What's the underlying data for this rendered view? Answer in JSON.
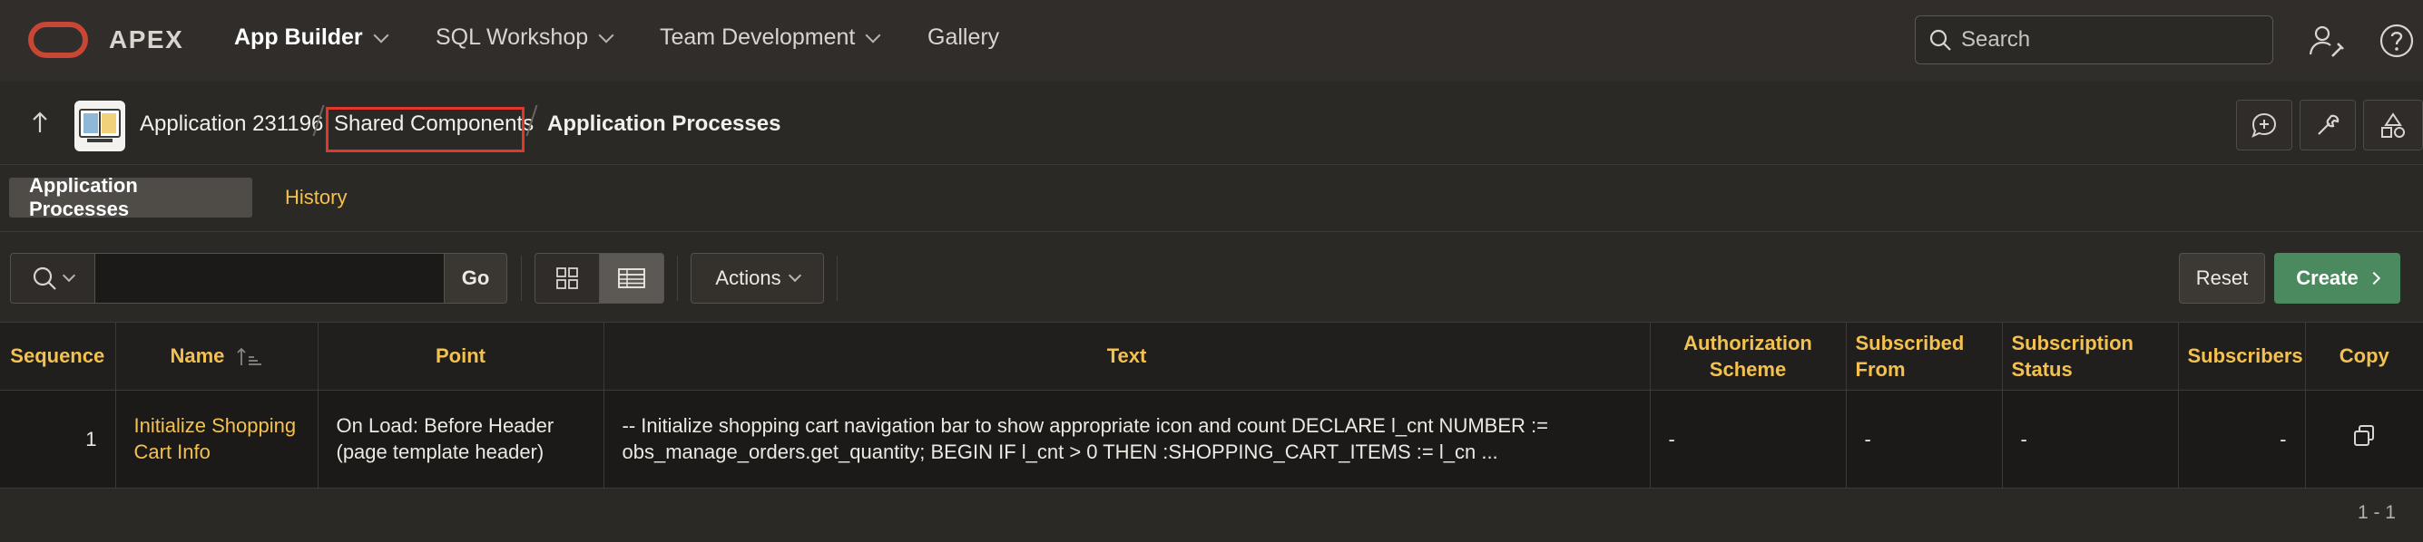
{
  "header": {
    "brand": "APEX",
    "nav": [
      {
        "label": "App Builder",
        "active": true,
        "has_menu": true
      },
      {
        "label": "SQL Workshop",
        "active": false,
        "has_menu": true
      },
      {
        "label": "Team Development",
        "active": false,
        "has_menu": true
      },
      {
        "label": "Gallery",
        "active": false,
        "has_menu": false
      }
    ],
    "search_placeholder": "Search",
    "icons": [
      "user-settings-icon",
      "help-icon"
    ],
    "colors": {
      "brand_red": "#c74634",
      "accent": "#f3c14f",
      "create_green": "#4b8a5e"
    }
  },
  "breadcrumb": {
    "items": [
      "Application 231196",
      "Shared Components",
      "Application Processes"
    ],
    "highlighted": "Shared Components",
    "tools": [
      "comment-add-icon",
      "wrench-icon",
      "shapes-icon"
    ]
  },
  "tabs": [
    {
      "label": "Application Processes",
      "active": true
    },
    {
      "label": "History",
      "active": false
    }
  ],
  "toolbar": {
    "search_value": "",
    "go_label": "Go",
    "actions_label": "Actions",
    "reset_label": "Reset",
    "create_label": "Create"
  },
  "table": {
    "columns": [
      "Sequence",
      "Name",
      "Point",
      "Text",
      "Authorization Scheme",
      "Subscribed From",
      "Subscription Status",
      "Subscribers",
      "Copy"
    ],
    "rows": [
      {
        "sequence": "1",
        "name": "Initialize Shopping Cart Info",
        "point": "On Load: Before Header (page template header)",
        "text": "-- Initialize shopping cart navigation bar to show appropriate icon and count DECLARE l_cnt NUMBER := obs_manage_orders.get_quantity; BEGIN IF l_cnt > 0 THEN :SHOPPING_CART_ITEMS := l_cn ...",
        "authorization_scheme": "-",
        "subscribed_from": "-",
        "subscription_status": "-",
        "subscribers": "-",
        "copy_icon": "copy-icon"
      }
    ]
  },
  "pagination": "1 - 1"
}
